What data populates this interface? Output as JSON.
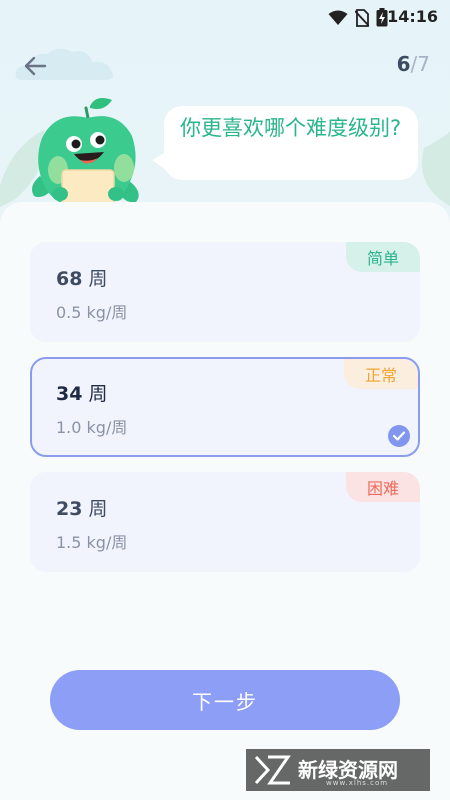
{
  "status_bar": {
    "time": "14:16",
    "icons": [
      "wifi-icon",
      "no-sim-icon",
      "battery-charging-icon"
    ]
  },
  "nav": {
    "back_icon": "arrow-left-icon",
    "progress_current": "6",
    "progress_separator": "/",
    "progress_total": "7"
  },
  "question": {
    "text": "你更喜欢哪个难度级别?"
  },
  "options": [
    {
      "weeks": "68",
      "unit": "周",
      "rate": "0.5 kg/周",
      "badge": "简单",
      "selected": false
    },
    {
      "weeks": "34",
      "unit": "周",
      "rate": "1.0 kg/周",
      "badge": "正常",
      "selected": true
    },
    {
      "weeks": "23",
      "unit": "周",
      "rate": "1.5 kg/周",
      "badge": "困难",
      "selected": false
    }
  ],
  "next_button": {
    "label": "下一步"
  },
  "watermark": {
    "text": "新绿资源网",
    "sub": "www.xlhs.com"
  },
  "colors": {
    "accent_green": "#29b68b",
    "primary_blue": "#8d9ef6",
    "selected_border": "#8c9cec",
    "badge_easy": "#2ab38c",
    "badge_normal": "#f0a535",
    "badge_hard": "#ef6a5a"
  }
}
